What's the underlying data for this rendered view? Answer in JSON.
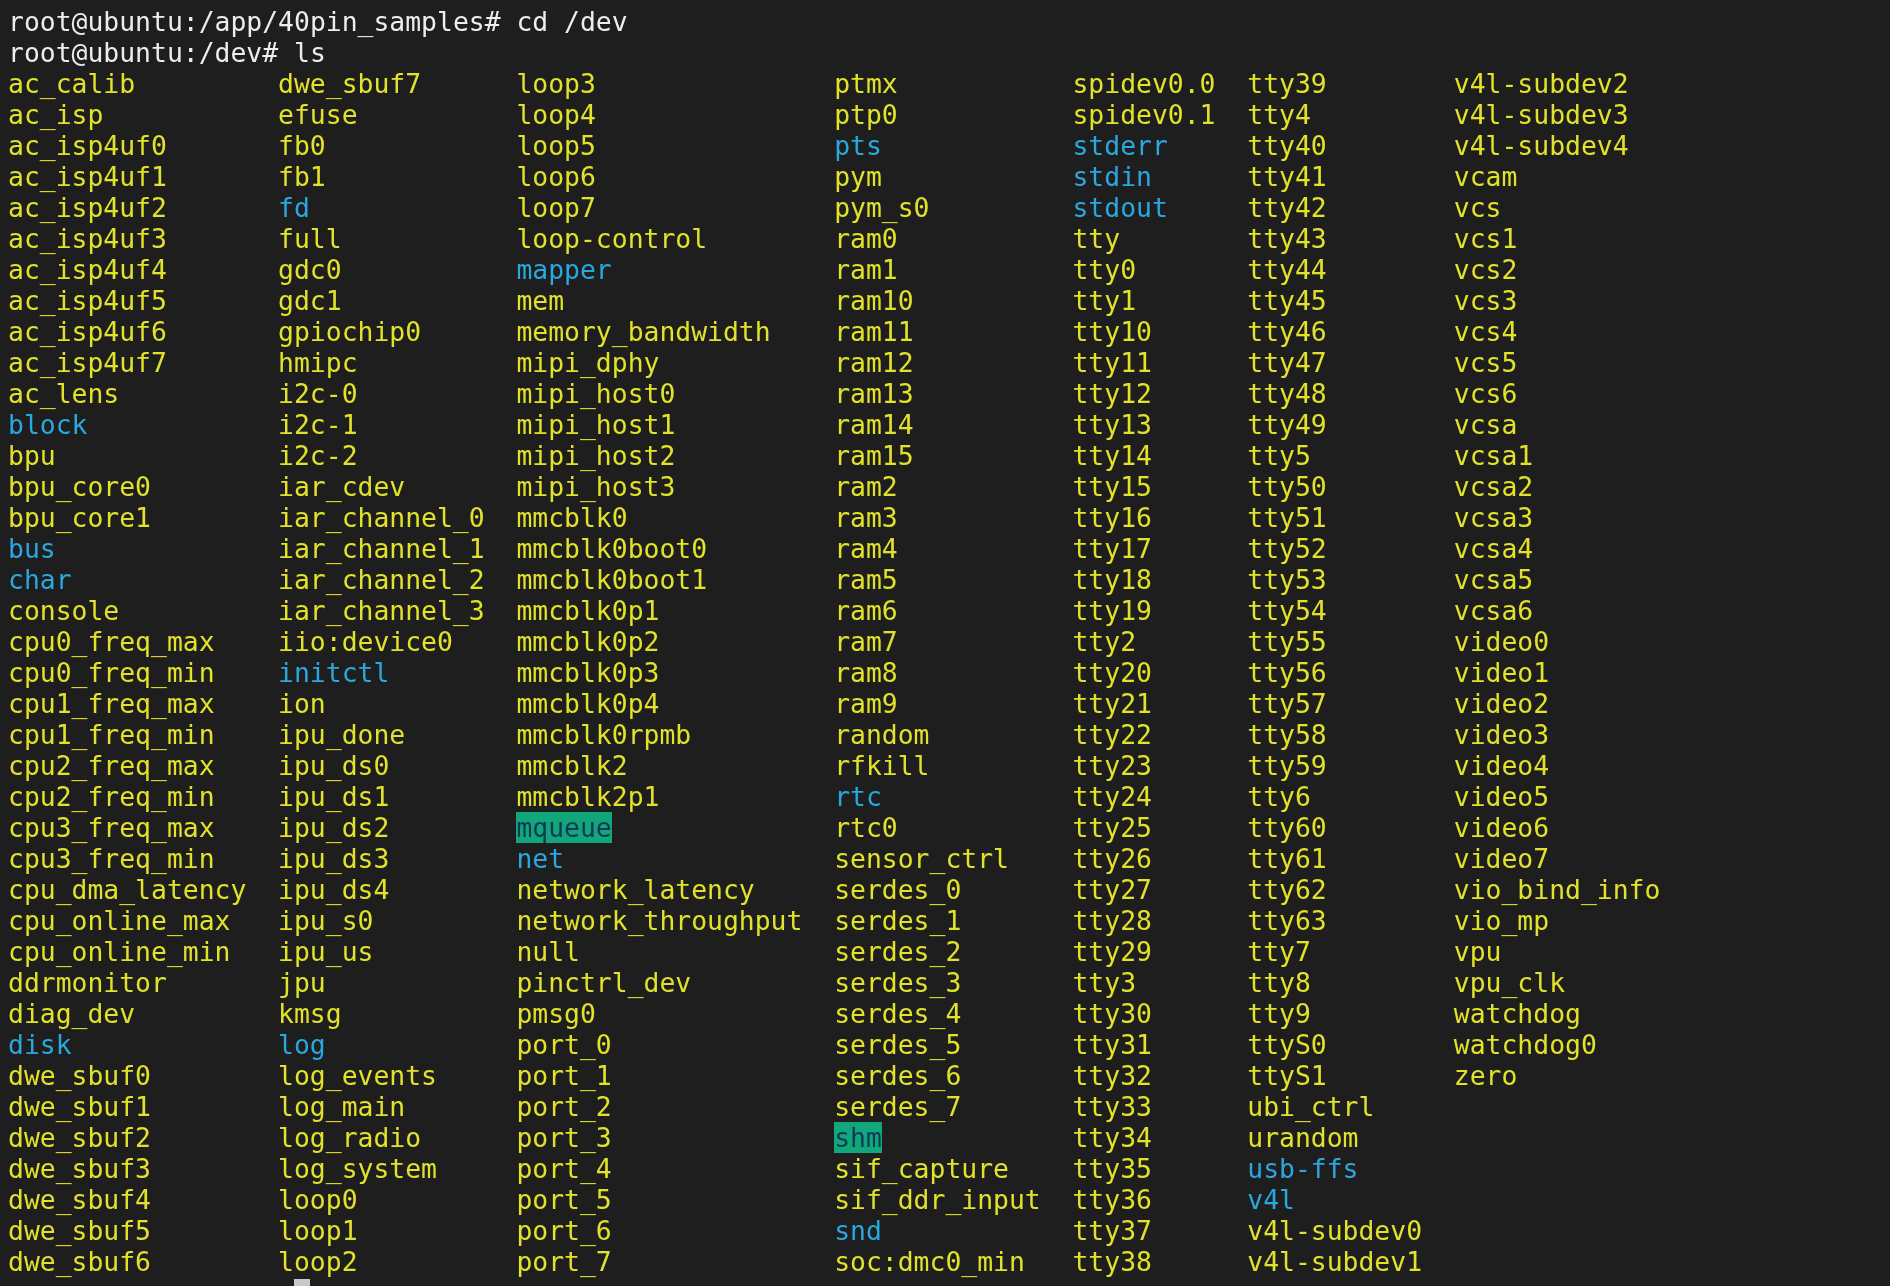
{
  "terminal": {
    "history": [
      {
        "prompt": "root@ubuntu:/app/40pin_samples#",
        "command": "cd /dev"
      },
      {
        "prompt": "root@ubuntu:/dev#",
        "command": "ls"
      }
    ],
    "listing": [
      [
        {
          "name": "ac_calib",
          "kind": "plain"
        },
        {
          "name": "ac_isp",
          "kind": "plain"
        },
        {
          "name": "ac_isp4uf0",
          "kind": "plain"
        },
        {
          "name": "ac_isp4uf1",
          "kind": "plain"
        },
        {
          "name": "ac_isp4uf2",
          "kind": "plain"
        },
        {
          "name": "ac_isp4uf3",
          "kind": "plain"
        },
        {
          "name": "ac_isp4uf4",
          "kind": "plain"
        },
        {
          "name": "ac_isp4uf5",
          "kind": "plain"
        },
        {
          "name": "ac_isp4uf6",
          "kind": "plain"
        },
        {
          "name": "ac_isp4uf7",
          "kind": "plain"
        },
        {
          "name": "ac_lens",
          "kind": "plain"
        },
        {
          "name": "block",
          "kind": "accent"
        },
        {
          "name": "bpu",
          "kind": "plain"
        },
        {
          "name": "bpu_core0",
          "kind": "plain"
        },
        {
          "name": "bpu_core1",
          "kind": "plain"
        },
        {
          "name": "bus",
          "kind": "accent"
        },
        {
          "name": "char",
          "kind": "accent"
        },
        {
          "name": "console",
          "kind": "plain"
        },
        {
          "name": "cpu0_freq_max",
          "kind": "plain"
        },
        {
          "name": "cpu0_freq_min",
          "kind": "plain"
        },
        {
          "name": "cpu1_freq_max",
          "kind": "plain"
        },
        {
          "name": "cpu1_freq_min",
          "kind": "plain"
        },
        {
          "name": "cpu2_freq_max",
          "kind": "plain"
        },
        {
          "name": "cpu2_freq_min",
          "kind": "plain"
        },
        {
          "name": "cpu3_freq_max",
          "kind": "plain"
        },
        {
          "name": "cpu3_freq_min",
          "kind": "plain"
        },
        {
          "name": "cpu_dma_latency",
          "kind": "plain"
        },
        {
          "name": "cpu_online_max",
          "kind": "plain"
        },
        {
          "name": "cpu_online_min",
          "kind": "plain"
        },
        {
          "name": "ddrmonitor",
          "kind": "plain"
        },
        {
          "name": "diag_dev",
          "kind": "plain"
        },
        {
          "name": "disk",
          "kind": "accent"
        },
        {
          "name": "dwe_sbuf0",
          "kind": "plain"
        },
        {
          "name": "dwe_sbuf1",
          "kind": "plain"
        },
        {
          "name": "dwe_sbuf2",
          "kind": "plain"
        },
        {
          "name": "dwe_sbuf3",
          "kind": "plain"
        },
        {
          "name": "dwe_sbuf4",
          "kind": "plain"
        },
        {
          "name": "dwe_sbuf5",
          "kind": "plain"
        },
        {
          "name": "dwe_sbuf6",
          "kind": "plain"
        }
      ],
      [
        {
          "name": "dwe_sbuf7",
          "kind": "plain"
        },
        {
          "name": "efuse",
          "kind": "plain"
        },
        {
          "name": "fb0",
          "kind": "plain"
        },
        {
          "name": "fb1",
          "kind": "plain"
        },
        {
          "name": "fd",
          "kind": "accent"
        },
        {
          "name": "full",
          "kind": "plain"
        },
        {
          "name": "gdc0",
          "kind": "plain"
        },
        {
          "name": "gdc1",
          "kind": "plain"
        },
        {
          "name": "gpiochip0",
          "kind": "plain"
        },
        {
          "name": "hmipc",
          "kind": "plain"
        },
        {
          "name": "i2c-0",
          "kind": "plain"
        },
        {
          "name": "i2c-1",
          "kind": "plain"
        },
        {
          "name": "i2c-2",
          "kind": "plain"
        },
        {
          "name": "iar_cdev",
          "kind": "plain"
        },
        {
          "name": "iar_channel_0",
          "kind": "plain"
        },
        {
          "name": "iar_channel_1",
          "kind": "plain"
        },
        {
          "name": "iar_channel_2",
          "kind": "plain"
        },
        {
          "name": "iar_channel_3",
          "kind": "plain"
        },
        {
          "name": "iio:device0",
          "kind": "plain"
        },
        {
          "name": "initctl",
          "kind": "accent"
        },
        {
          "name": "ion",
          "kind": "plain"
        },
        {
          "name": "ipu_done",
          "kind": "plain"
        },
        {
          "name": "ipu_ds0",
          "kind": "plain"
        },
        {
          "name": "ipu_ds1",
          "kind": "plain"
        },
        {
          "name": "ipu_ds2",
          "kind": "plain"
        },
        {
          "name": "ipu_ds3",
          "kind": "plain"
        },
        {
          "name": "ipu_ds4",
          "kind": "plain"
        },
        {
          "name": "ipu_s0",
          "kind": "plain"
        },
        {
          "name": "ipu_us",
          "kind": "plain"
        },
        {
          "name": "jpu",
          "kind": "plain"
        },
        {
          "name": "kmsg",
          "kind": "plain"
        },
        {
          "name": "log",
          "kind": "accent"
        },
        {
          "name": "log_events",
          "kind": "plain"
        },
        {
          "name": "log_main",
          "kind": "plain"
        },
        {
          "name": "log_radio",
          "kind": "plain"
        },
        {
          "name": "log_system",
          "kind": "plain"
        },
        {
          "name": "loop0",
          "kind": "plain"
        },
        {
          "name": "loop1",
          "kind": "plain"
        },
        {
          "name": "loop2",
          "kind": "plain"
        }
      ],
      [
        {
          "name": "loop3",
          "kind": "plain"
        },
        {
          "name": "loop4",
          "kind": "plain"
        },
        {
          "name": "loop5",
          "kind": "plain"
        },
        {
          "name": "loop6",
          "kind": "plain"
        },
        {
          "name": "loop7",
          "kind": "plain"
        },
        {
          "name": "loop-control",
          "kind": "plain"
        },
        {
          "name": "mapper",
          "kind": "accent"
        },
        {
          "name": "mem",
          "kind": "plain"
        },
        {
          "name": "memory_bandwidth",
          "kind": "plain"
        },
        {
          "name": "mipi_dphy",
          "kind": "plain"
        },
        {
          "name": "mipi_host0",
          "kind": "plain"
        },
        {
          "name": "mipi_host1",
          "kind": "plain"
        },
        {
          "name": "mipi_host2",
          "kind": "plain"
        },
        {
          "name": "mipi_host3",
          "kind": "plain"
        },
        {
          "name": "mmcblk0",
          "kind": "plain"
        },
        {
          "name": "mmcblk0boot0",
          "kind": "plain"
        },
        {
          "name": "mmcblk0boot1",
          "kind": "plain"
        },
        {
          "name": "mmcblk0p1",
          "kind": "plain"
        },
        {
          "name": "mmcblk0p2",
          "kind": "plain"
        },
        {
          "name": "mmcblk0p3",
          "kind": "plain"
        },
        {
          "name": "mmcblk0p4",
          "kind": "plain"
        },
        {
          "name": "mmcblk0rpmb",
          "kind": "plain"
        },
        {
          "name": "mmcblk2",
          "kind": "plain"
        },
        {
          "name": "mmcblk2p1",
          "kind": "plain"
        },
        {
          "name": "mqueue",
          "kind": "marked"
        },
        {
          "name": "net",
          "kind": "accent"
        },
        {
          "name": "network_latency",
          "kind": "plain"
        },
        {
          "name": "network_throughput",
          "kind": "plain"
        },
        {
          "name": "null",
          "kind": "plain"
        },
        {
          "name": "pinctrl_dev",
          "kind": "plain"
        },
        {
          "name": "pmsg0",
          "kind": "plain"
        },
        {
          "name": "port_0",
          "kind": "plain"
        },
        {
          "name": "port_1",
          "kind": "plain"
        },
        {
          "name": "port_2",
          "kind": "plain"
        },
        {
          "name": "port_3",
          "kind": "plain"
        },
        {
          "name": "port_4",
          "kind": "plain"
        },
        {
          "name": "port_5",
          "kind": "plain"
        },
        {
          "name": "port_6",
          "kind": "plain"
        },
        {
          "name": "port_7",
          "kind": "plain"
        }
      ],
      [
        {
          "name": "ptmx",
          "kind": "plain"
        },
        {
          "name": "ptp0",
          "kind": "plain"
        },
        {
          "name": "pts",
          "kind": "accent"
        },
        {
          "name": "pym",
          "kind": "plain"
        },
        {
          "name": "pym_s0",
          "kind": "plain"
        },
        {
          "name": "ram0",
          "kind": "plain"
        },
        {
          "name": "ram1",
          "kind": "plain"
        },
        {
          "name": "ram10",
          "kind": "plain"
        },
        {
          "name": "ram11",
          "kind": "plain"
        },
        {
          "name": "ram12",
          "kind": "plain"
        },
        {
          "name": "ram13",
          "kind": "plain"
        },
        {
          "name": "ram14",
          "kind": "plain"
        },
        {
          "name": "ram15",
          "kind": "plain"
        },
        {
          "name": "ram2",
          "kind": "plain"
        },
        {
          "name": "ram3",
          "kind": "plain"
        },
        {
          "name": "ram4",
          "kind": "plain"
        },
        {
          "name": "ram5",
          "kind": "plain"
        },
        {
          "name": "ram6",
          "kind": "plain"
        },
        {
          "name": "ram7",
          "kind": "plain"
        },
        {
          "name": "ram8",
          "kind": "plain"
        },
        {
          "name": "ram9",
          "kind": "plain"
        },
        {
          "name": "random",
          "kind": "plain"
        },
        {
          "name": "rfkill",
          "kind": "plain"
        },
        {
          "name": "rtc",
          "kind": "accent"
        },
        {
          "name": "rtc0",
          "kind": "plain"
        },
        {
          "name": "sensor_ctrl",
          "kind": "plain"
        },
        {
          "name": "serdes_0",
          "kind": "plain"
        },
        {
          "name": "serdes_1",
          "kind": "plain"
        },
        {
          "name": "serdes_2",
          "kind": "plain"
        },
        {
          "name": "serdes_3",
          "kind": "plain"
        },
        {
          "name": "serdes_4",
          "kind": "plain"
        },
        {
          "name": "serdes_5",
          "kind": "plain"
        },
        {
          "name": "serdes_6",
          "kind": "plain"
        },
        {
          "name": "serdes_7",
          "kind": "plain"
        },
        {
          "name": "shm",
          "kind": "marked"
        },
        {
          "name": "sif_capture",
          "kind": "plain"
        },
        {
          "name": "sif_ddr_input",
          "kind": "plain"
        },
        {
          "name": "snd",
          "kind": "accent"
        },
        {
          "name": "soc:dmc0_min",
          "kind": "plain"
        }
      ],
      [
        {
          "name": "spidev0.0",
          "kind": "plain"
        },
        {
          "name": "spidev0.1",
          "kind": "plain"
        },
        {
          "name": "stderr",
          "kind": "accent"
        },
        {
          "name": "stdin",
          "kind": "accent"
        },
        {
          "name": "stdout",
          "kind": "accent"
        },
        {
          "name": "tty",
          "kind": "plain"
        },
        {
          "name": "tty0",
          "kind": "plain"
        },
        {
          "name": "tty1",
          "kind": "plain"
        },
        {
          "name": "tty10",
          "kind": "plain"
        },
        {
          "name": "tty11",
          "kind": "plain"
        },
        {
          "name": "tty12",
          "kind": "plain"
        },
        {
          "name": "tty13",
          "kind": "plain"
        },
        {
          "name": "tty14",
          "kind": "plain"
        },
        {
          "name": "tty15",
          "kind": "plain"
        },
        {
          "name": "tty16",
          "kind": "plain"
        },
        {
          "name": "tty17",
          "kind": "plain"
        },
        {
          "name": "tty18",
          "kind": "plain"
        },
        {
          "name": "tty19",
          "kind": "plain"
        },
        {
          "name": "tty2",
          "kind": "plain"
        },
        {
          "name": "tty20",
          "kind": "plain"
        },
        {
          "name": "tty21",
          "kind": "plain"
        },
        {
          "name": "tty22",
          "kind": "plain"
        },
        {
          "name": "tty23",
          "kind": "plain"
        },
        {
          "name": "tty24",
          "kind": "plain"
        },
        {
          "name": "tty25",
          "kind": "plain"
        },
        {
          "name": "tty26",
          "kind": "plain"
        },
        {
          "name": "tty27",
          "kind": "plain"
        },
        {
          "name": "tty28",
          "kind": "plain"
        },
        {
          "name": "tty29",
          "kind": "plain"
        },
        {
          "name": "tty3",
          "kind": "plain"
        },
        {
          "name": "tty30",
          "kind": "plain"
        },
        {
          "name": "tty31",
          "kind": "plain"
        },
        {
          "name": "tty32",
          "kind": "plain"
        },
        {
          "name": "tty33",
          "kind": "plain"
        },
        {
          "name": "tty34",
          "kind": "plain"
        },
        {
          "name": "tty35",
          "kind": "plain"
        },
        {
          "name": "tty36",
          "kind": "plain"
        },
        {
          "name": "tty37",
          "kind": "plain"
        },
        {
          "name": "tty38",
          "kind": "plain"
        }
      ],
      [
        {
          "name": "tty39",
          "kind": "plain"
        },
        {
          "name": "tty4",
          "kind": "plain"
        },
        {
          "name": "tty40",
          "kind": "plain"
        },
        {
          "name": "tty41",
          "kind": "plain"
        },
        {
          "name": "tty42",
          "kind": "plain"
        },
        {
          "name": "tty43",
          "kind": "plain"
        },
        {
          "name": "tty44",
          "kind": "plain"
        },
        {
          "name": "tty45",
          "kind": "plain"
        },
        {
          "name": "tty46",
          "kind": "plain"
        },
        {
          "name": "tty47",
          "kind": "plain"
        },
        {
          "name": "tty48",
          "kind": "plain"
        },
        {
          "name": "tty49",
          "kind": "plain"
        },
        {
          "name": "tty5",
          "kind": "plain"
        },
        {
          "name": "tty50",
          "kind": "plain"
        },
        {
          "name": "tty51",
          "kind": "plain"
        },
        {
          "name": "tty52",
          "kind": "plain"
        },
        {
          "name": "tty53",
          "kind": "plain"
        },
        {
          "name": "tty54",
          "kind": "plain"
        },
        {
          "name": "tty55",
          "kind": "plain"
        },
        {
          "name": "tty56",
          "kind": "plain"
        },
        {
          "name": "tty57",
          "kind": "plain"
        },
        {
          "name": "tty58",
          "kind": "plain"
        },
        {
          "name": "tty59",
          "kind": "plain"
        },
        {
          "name": "tty6",
          "kind": "plain"
        },
        {
          "name": "tty60",
          "kind": "plain"
        },
        {
          "name": "tty61",
          "kind": "plain"
        },
        {
          "name": "tty62",
          "kind": "plain"
        },
        {
          "name": "tty63",
          "kind": "plain"
        },
        {
          "name": "tty7",
          "kind": "plain"
        },
        {
          "name": "tty8",
          "kind": "plain"
        },
        {
          "name": "tty9",
          "kind": "plain"
        },
        {
          "name": "ttyS0",
          "kind": "plain"
        },
        {
          "name": "ttyS1",
          "kind": "plain"
        },
        {
          "name": "ubi_ctrl",
          "kind": "plain"
        },
        {
          "name": "urandom",
          "kind": "plain"
        },
        {
          "name": "usb-ffs",
          "kind": "accent"
        },
        {
          "name": "v4l",
          "kind": "accent"
        },
        {
          "name": "v4l-subdev0",
          "kind": "plain"
        },
        {
          "name": "v4l-subdev1",
          "kind": "plain"
        }
      ],
      [
        {
          "name": "v4l-subdev2",
          "kind": "plain"
        },
        {
          "name": "v4l-subdev3",
          "kind": "plain"
        },
        {
          "name": "v4l-subdev4",
          "kind": "plain"
        },
        {
          "name": "vcam",
          "kind": "plain"
        },
        {
          "name": "vcs",
          "kind": "plain"
        },
        {
          "name": "vcs1",
          "kind": "plain"
        },
        {
          "name": "vcs2",
          "kind": "plain"
        },
        {
          "name": "vcs3",
          "kind": "plain"
        },
        {
          "name": "vcs4",
          "kind": "plain"
        },
        {
          "name": "vcs5",
          "kind": "plain"
        },
        {
          "name": "vcs6",
          "kind": "plain"
        },
        {
          "name": "vcsa",
          "kind": "plain"
        },
        {
          "name": "vcsa1",
          "kind": "plain"
        },
        {
          "name": "vcsa2",
          "kind": "plain"
        },
        {
          "name": "vcsa3",
          "kind": "plain"
        },
        {
          "name": "vcsa4",
          "kind": "plain"
        },
        {
          "name": "vcsa5",
          "kind": "plain"
        },
        {
          "name": "vcsa6",
          "kind": "plain"
        },
        {
          "name": "video0",
          "kind": "plain"
        },
        {
          "name": "video1",
          "kind": "plain"
        },
        {
          "name": "video2",
          "kind": "plain"
        },
        {
          "name": "video3",
          "kind": "plain"
        },
        {
          "name": "video4",
          "kind": "plain"
        },
        {
          "name": "video5",
          "kind": "plain"
        },
        {
          "name": "video6",
          "kind": "plain"
        },
        {
          "name": "video7",
          "kind": "plain"
        },
        {
          "name": "vio_bind_info",
          "kind": "plain"
        },
        {
          "name": "vio_mp",
          "kind": "plain"
        },
        {
          "name": "vpu",
          "kind": "plain"
        },
        {
          "name": "vpu_clk",
          "kind": "plain"
        },
        {
          "name": "watchdog",
          "kind": "plain"
        },
        {
          "name": "watchdog0",
          "kind": "plain"
        },
        {
          "name": "zero",
          "kind": "plain"
        }
      ]
    ]
  }
}
